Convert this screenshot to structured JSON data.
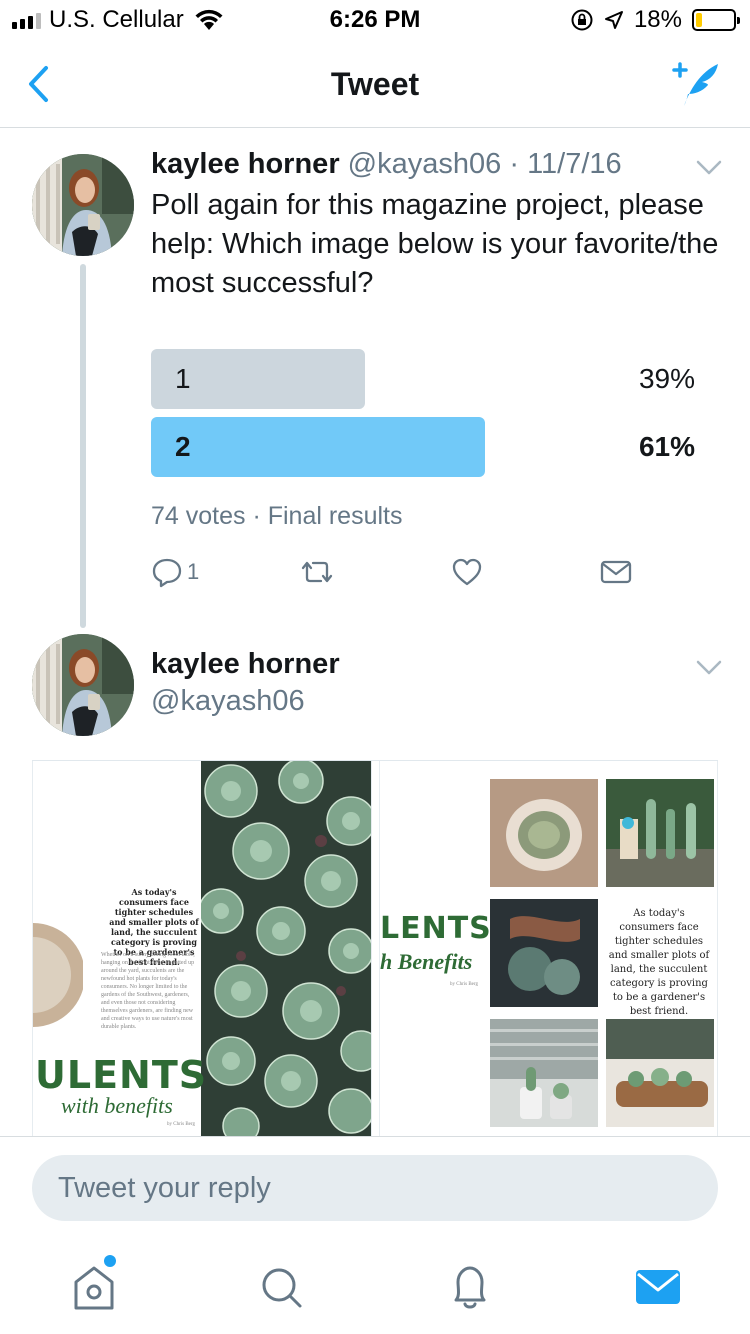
{
  "status_bar": {
    "carrier": "U.S. Cellular",
    "time": "6:26 PM",
    "battery_percent": "18%",
    "battery_level": 0.18,
    "icons": [
      "signal-icon",
      "wifi-icon",
      "rotation-lock-icon",
      "location-icon",
      "battery-icon"
    ]
  },
  "nav": {
    "title": "Tweet",
    "back_icon": "chevron-left-icon",
    "compose_icon": "compose-tweet-icon"
  },
  "tweet": {
    "author_name": "kaylee horner",
    "handle": "@kayash06",
    "separator": "·",
    "date": "11/7/16",
    "text": "Poll again for this magazine project, please help: Which image below is your favorite/the most successful?",
    "poll": {
      "options": [
        {
          "label": "1",
          "percent_text": "39%",
          "percent": 39,
          "winner": false
        },
        {
          "label": "2",
          "percent_text": "61%",
          "percent": 61,
          "winner": true
        }
      ],
      "meta": "74 votes · Final results"
    },
    "actions": {
      "reply_count": "1",
      "icons": [
        "reply-icon",
        "retweet-icon",
        "like-icon",
        "direct-message-icon"
      ]
    }
  },
  "reply_tweet": {
    "author_name": "kaylee horner",
    "handle": "@kayash06",
    "media": {
      "left_page": {
        "quote": "As today's consumers face tighter schedules and smaller plots of land, the succulent category is proving to be a gardener's best friend.",
        "body": "Whether on a sunny dining room table, hanging on the front door, or potted up around the yard, succulents are the newfound hot plants for today's consumers. No longer limited to the gardens of the Southwest, gardeners, and even those not considering themselves gardeners, are finding new and creative ways to use nature's most durable plants.",
        "title": "ULENTS",
        "subtitle": "with benefits",
        "byline": "by Chris Berg"
      },
      "right_page": {
        "title": "LENTS",
        "subtitle": "h Benefits",
        "byline": "by Chris Berg",
        "quote": "As today's consumers face tighter schedules and smaller plots of land, the succulent category is proving to be a gardener's best friend."
      }
    }
  },
  "reply_box": {
    "placeholder": "Tweet your reply"
  },
  "tab_bar": {
    "items": [
      "home-icon",
      "search-icon",
      "notifications-icon",
      "messages-icon"
    ],
    "colors": {
      "active": "#1da1f2",
      "inactive": "#657786"
    }
  },
  "colors": {
    "accent": "#1da1f2",
    "poll_winner": "#71c9f8",
    "poll_other": "#ccd6dd",
    "muted_text": "#657786"
  }
}
